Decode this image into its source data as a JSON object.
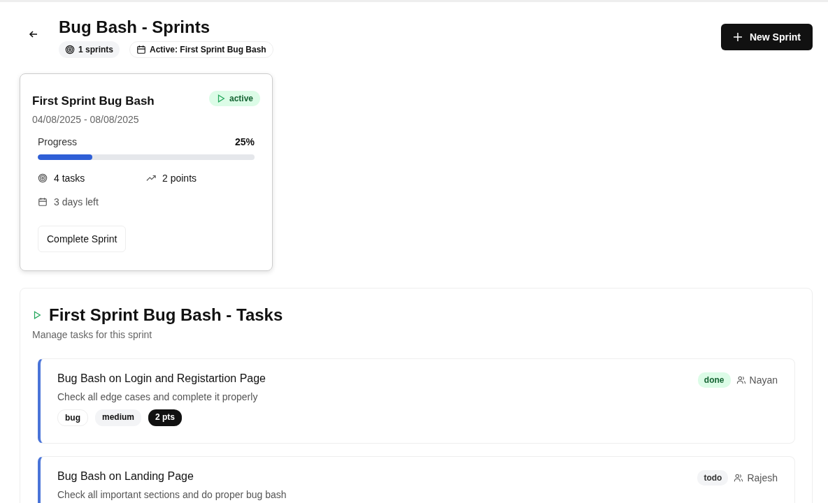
{
  "header": {
    "title": "Bug Bash - Sprints",
    "badges": [
      {
        "kind": "count",
        "label": "1 sprints"
      },
      {
        "kind": "active",
        "label": "Active: First Sprint Bug Bash"
      }
    ],
    "new_button": "New Sprint"
  },
  "sprints": [
    {
      "name": "First Sprint Bug Bash",
      "status": "active",
      "dates": "04/08/2025 - 08/08/2025",
      "progress_label": "Progress",
      "progress_value": "25%",
      "level": 0.25,
      "tasks": "4 tasks",
      "points": "2 points",
      "days_left": "3 days left",
      "action": "Complete Sprint"
    }
  ],
  "tasks_panel": {
    "title": "First Sprint Bug Bash - Tasks",
    "subtitle": "Manage tasks for this sprint",
    "tasks": [
      {
        "title": "Bug Bash on Login and Registartion Page",
        "description": "Check all edge cases and complete it properly",
        "status": "done",
        "assignee": "Nayan",
        "tags": [
          {
            "kind": "type",
            "label": "bug"
          },
          {
            "kind": "priority",
            "label": "medium"
          },
          {
            "kind": "points",
            "label": "2 pts"
          }
        ]
      },
      {
        "title": "Bug Bash on Landing Page",
        "description": "Check all important sections and do proper bug bash",
        "status": "todo",
        "assignee": "Rajesh"
      }
    ]
  }
}
